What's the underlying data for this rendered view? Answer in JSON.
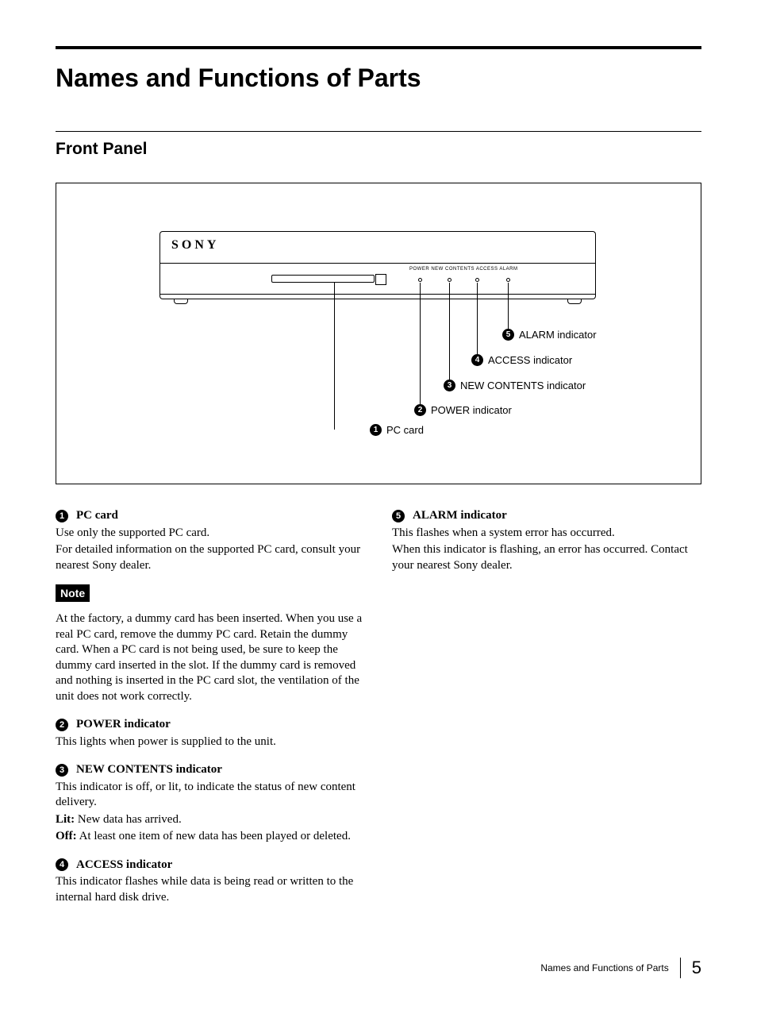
{
  "title": "Names and Functions of Parts",
  "section": "Front Panel",
  "brand": "SONY",
  "tiny_labels": "POWER  NEW CONTENTS  ACCESS     ALARM",
  "callouts": {
    "c5": "ALARM indicator",
    "c4": "ACCESS indicator",
    "c3": "NEW CONTENTS indicator",
    "c2": "POWER indicator",
    "c1": "PC card"
  },
  "left": {
    "i1_title": "PC card",
    "i1_p1": "Use only the supported PC card.",
    "i1_p2": "For detailed information on the supported PC card, consult your nearest Sony dealer.",
    "note_label": "Note",
    "note_body": "At the factory, a dummy card has been inserted. When you use a real PC card, remove the dummy PC card. Retain the dummy card. When a PC card is not being used, be sure to keep the dummy card inserted in the slot. If the dummy card is removed and nothing is inserted in the PC card slot, the ventilation of the unit does not work correctly.",
    "i2_title": "POWER indicator",
    "i2_p1": "This lights when power is supplied to the unit.",
    "i3_title": "NEW CONTENTS indicator",
    "i3_p1": "This indicator is off, or lit, to indicate the status of new content delivery.",
    "i3_lit_label": "Lit:",
    "i3_lit_text": " New data has arrived.",
    "i3_off_label": "Off:",
    "i3_off_text": " At least one item of new data has been played or deleted.",
    "i4_title": "ACCESS indicator",
    "i4_p1": "This indicator flashes while data is being read or written to the internal hard disk drive."
  },
  "right": {
    "i5_title": "ALARM indicator",
    "i5_p1": "This flashes when a system error has occurred.",
    "i5_p2": "When this indicator is flashing, an error has occurred. Contact your nearest Sony dealer."
  },
  "footer": {
    "text": "Names and Functions of Parts",
    "page": "5"
  }
}
